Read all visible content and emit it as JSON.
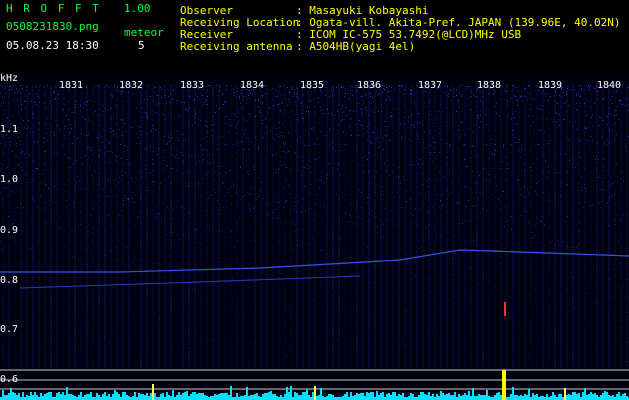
{
  "header": {
    "program": "H R O F F T",
    "version": "1.00",
    "filename": "0508231830.png",
    "datetime": "05.08.23 18:30",
    "meteor_label": "meteor",
    "meteor_count": "5",
    "fields": [
      {
        "label": "Observer",
        "value": ": Masayuki Kobayashi"
      },
      {
        "label": "Receiving Location",
        "value": ": Ogata-vill. Akita-Pref. JAPAN (139.96E, 40.02N)"
      },
      {
        "label": "Receiver",
        "value": ": ICOM IC-575 53.7492(@LCD)MHz USB"
      },
      {
        "label": "Receiving antenna",
        "value": ": A504HB(yagi 4el)"
      }
    ]
  },
  "spectrogram": {
    "y_unit": "kHz",
    "y_ticks": [
      "1.1",
      "1.0",
      "0.9",
      "0.8",
      "0.7",
      "0.6"
    ],
    "x_ticks": [
      "1831",
      "1832",
      "1833",
      "1834",
      "1835",
      "1836",
      "1837",
      "1838",
      "1839",
      "1840"
    ],
    "colors": {
      "background": "#000010",
      "noise": "#2a3cff",
      "signal": "#ffff00",
      "baseline": "#00e0ff"
    }
  }
}
